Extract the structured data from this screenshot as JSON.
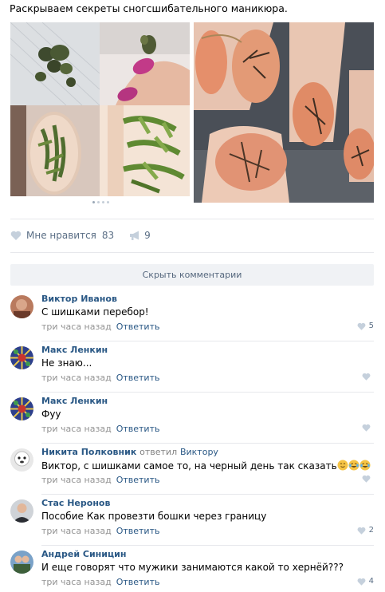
{
  "post": {
    "text": "Раскрываем секреты сногсшибательного маникюра."
  },
  "actions": {
    "like_label": "Мне нравится",
    "like_count": "83",
    "share_count": "9"
  },
  "hide_comments_label": "Скрыть комментарии",
  "comments": [
    {
      "author": "Виктор Иванов",
      "reply_to": "",
      "reply_verb": "",
      "text": "С шишками перебор!",
      "time": "три часа назад",
      "answer": "Ответить",
      "likes": "5"
    },
    {
      "author": "Макс Ленкин",
      "reply_to": "",
      "reply_verb": "",
      "text": "Не знаю...",
      "time": "три часа назад",
      "answer": "Ответить",
      "likes": ""
    },
    {
      "author": "Макс Ленкин",
      "reply_to": "",
      "reply_verb": "",
      "text": "Фуу",
      "time": "три часа назад",
      "answer": "Ответить",
      "likes": ""
    },
    {
      "author": "Никита Полковник",
      "reply_verb": "ответил",
      "reply_to": "Виктору",
      "text": "Виктор, с шишками самое то, на черный день так сказать",
      "time": "три часа назад",
      "answer": "Ответить",
      "likes": ""
    },
    {
      "author": "Стас Неронов",
      "reply_to": "",
      "reply_verb": "",
      "text": "Пособие Как провезти бошки через границу",
      "time": "три часа назад",
      "answer": "Ответить",
      "likes": "2"
    },
    {
      "author": "Андрей Синицин",
      "reply_to": "",
      "reply_verb": "",
      "text": "И еще говорят что мужики занимаются какой то хернёй???",
      "time": "три часа назад",
      "answer": "Ответить",
      "likes": "4"
    }
  ],
  "colors": {
    "link": "#2a5885",
    "muted": "#939393",
    "action": "#5a6e85",
    "button_bg": "#f0f2f5"
  },
  "icons": {
    "like": "heart-icon",
    "share": "megaphone-icon",
    "emoji": "smiling-face-icon",
    "laugh": "tears-of-joy-icon"
  }
}
